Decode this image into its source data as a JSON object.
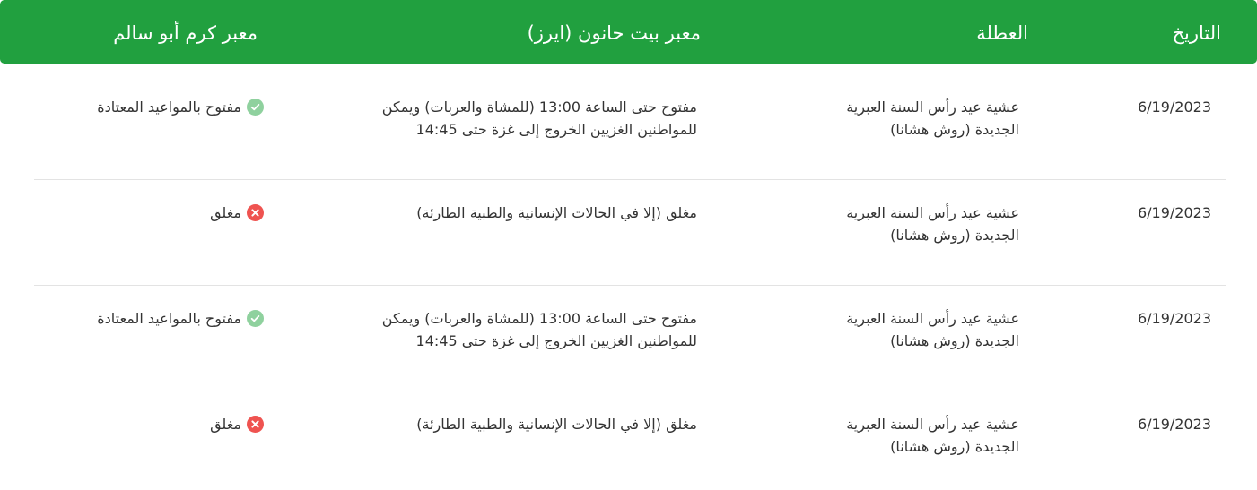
{
  "header": {
    "date": "التاريخ",
    "holiday": "العطلة",
    "erez": "معبر بيت حانون (ايرز)",
    "kerem": "معبر كرم أبو سالم"
  },
  "rows": [
    {
      "date": "6/19/2023",
      "holiday": "عشية عيد رأس السنة العبرية الجديدة (روش هشانا)",
      "erez": "مفتوح حتى الساعة 13:00 (للمشاة والعربات) ويمكن للمواطنين الغزيين الخروج إلى غزة حتى 14:45",
      "kerem": "مفتوح بالمواعيد المعتادة",
      "kerem_status": "open"
    },
    {
      "date": "6/19/2023",
      "holiday": "عشية عيد رأس السنة العبرية الجديدة (روش هشانا)",
      "erez": "مغلق (إلا في الحالات الإنسانية والطبية الطارئة)",
      "kerem": "مغلق",
      "kerem_status": "closed"
    },
    {
      "date": "6/19/2023",
      "holiday": "عشية عيد رأس السنة العبرية الجديدة (روش هشانا)",
      "erez": "مفتوح حتى الساعة 13:00 (للمشاة والعربات) ويمكن للمواطنين الغزيين الخروج إلى غزة حتى 14:45",
      "kerem": "مفتوح بالمواعيد المعتادة",
      "kerem_status": "open"
    },
    {
      "date": "6/19/2023",
      "holiday": "عشية عيد رأس السنة العبرية الجديدة (روش هشانا)",
      "erez": "مغلق (إلا في الحالات الإنسانية والطبية الطارئة)",
      "kerem": "مغلق",
      "kerem_status": "closed"
    }
  ],
  "colors": {
    "header_bg": "#21a03f",
    "header_text": "#ffffff",
    "text": "#333333",
    "divider": "#e3e3e3",
    "open_badge": "#8fd19e",
    "closed_badge": "#ef5350"
  },
  "icons": {
    "open": "check-circle-icon",
    "closed": "x-circle-icon"
  }
}
